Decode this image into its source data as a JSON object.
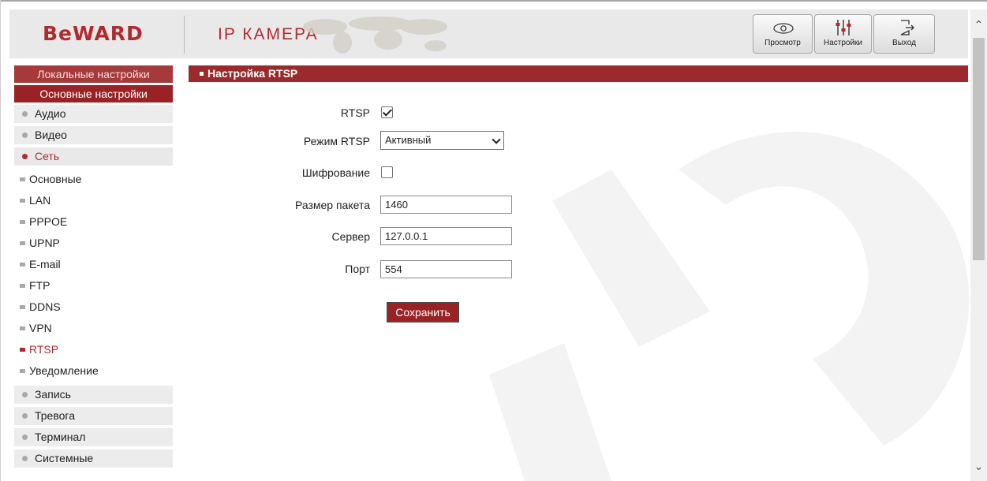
{
  "header": {
    "logo": "BeWARD",
    "title": "IP КАМЕРА",
    "buttons": {
      "view": {
        "label": "Просмотр",
        "icon": "eye-icon"
      },
      "settings": {
        "label": "Настройки",
        "icon": "sliders-icon"
      },
      "exit": {
        "label": "Выход",
        "icon": "exit-icon"
      }
    }
  },
  "sidebar": {
    "local_settings": "Локальные настройки",
    "main_settings": "Основные настройки",
    "audio": "Аудио",
    "video": "Видео",
    "network": "Сеть",
    "network_sub": {
      "basic": "Основные",
      "lan": "LAN",
      "pppoe": "PPPOE",
      "upnp": "UPNP",
      "email": "E-mail",
      "ftp": "FTP",
      "ddns": "DDNS",
      "vpn": "VPN",
      "rtsp": "RTSP",
      "notification": "Уведомление"
    },
    "record": "Запись",
    "alarm": "Тревога",
    "terminal": "Терминал",
    "system": "Системные"
  },
  "section": {
    "title": "Настройка RTSP"
  },
  "form": {
    "rtsp_label": "RTSP",
    "rtsp_enabled": true,
    "mode_label": "Режим RTSP",
    "mode_value": "Активный",
    "encryption_label": "Шифрование",
    "encryption_enabled": false,
    "packet_label": "Размер пакета",
    "packet_value": "1460",
    "server_label": "Сервер",
    "server_value": "127.0.0.1",
    "port_label": "Порт",
    "port_value": "554",
    "save_label": "Сохранить"
  },
  "colors": {
    "brand_red": "#9b2224",
    "header_bg": "#e9e9e9",
    "menu_bg": "#ececec"
  }
}
